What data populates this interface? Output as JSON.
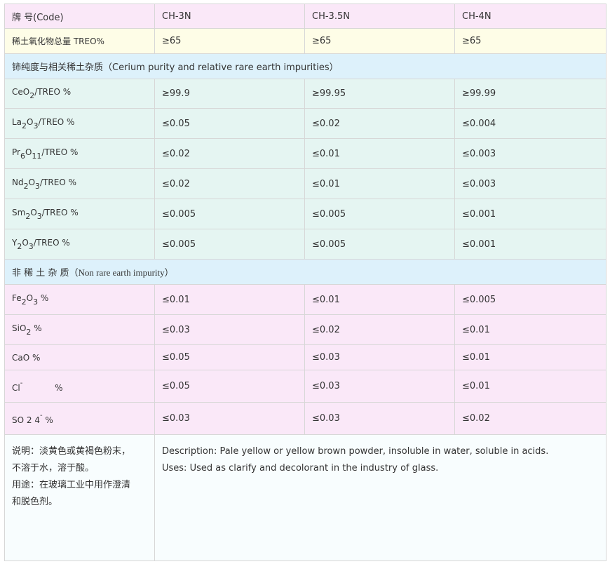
{
  "header": {
    "code_label": "牌 号(Code)",
    "grades": [
      "CH-3N",
      "CH-3.5N",
      "CH-4N"
    ]
  },
  "treo": {
    "label": "稀土氧化物总量 TREO%",
    "values": [
      "≥65",
      "≥65",
      "≥65"
    ]
  },
  "section1": {
    "title": "铈纯度与相关稀土杂质（Cerium purity and relative rare earth impurities）"
  },
  "ree_rows": [
    {
      "formula": [
        {
          "t": "CeO"
        },
        {
          "s": "2"
        },
        {
          "t": "/TREO %"
        }
      ],
      "values": [
        "≥99.9",
        "≥99.95",
        "≥99.99"
      ]
    },
    {
      "formula": [
        {
          "t": "La"
        },
        {
          "s": "2"
        },
        {
          "t": "O"
        },
        {
          "s": "3"
        },
        {
          "t": "/TREO %"
        }
      ],
      "values": [
        "≤0.05",
        "≤0.02",
        "≤0.004"
      ]
    },
    {
      "formula": [
        {
          "t": "Pr"
        },
        {
          "s": "6"
        },
        {
          "t": "O"
        },
        {
          "s": "11"
        },
        {
          "t": "/TREO %"
        }
      ],
      "values": [
        "≤0.02",
        "≤0.01",
        "≤0.003"
      ]
    },
    {
      "formula": [
        {
          "t": "Nd"
        },
        {
          "s": "2"
        },
        {
          "t": "O"
        },
        {
          "s": "3"
        },
        {
          "t": "/TREO %"
        }
      ],
      "values": [
        "≤0.02",
        "≤0.01",
        "≤0.003"
      ]
    },
    {
      "formula": [
        {
          "t": "Sm"
        },
        {
          "s": "2"
        },
        {
          "t": "O"
        },
        {
          "s": "3"
        },
        {
          "t": "/TREO %"
        }
      ],
      "values": [
        "≤0.005",
        "≤0.005",
        "≤0.001"
      ]
    },
    {
      "formula": [
        {
          "t": "Y"
        },
        {
          "s": "2"
        },
        {
          "t": "O"
        },
        {
          "s": "3"
        },
        {
          "t": "/TREO %"
        }
      ],
      "values": [
        "≤0.005",
        "≤0.005",
        "≤0.001"
      ]
    }
  ],
  "section2": {
    "title_cn": "非 稀 土 杂 质",
    "title_en": "（Non rare earth impurity）"
  },
  "non_ree_rows": [
    {
      "formula": [
        {
          "t": "Fe"
        },
        {
          "s": "2"
        },
        {
          "t": "O"
        },
        {
          "s": "3"
        },
        {
          "t": " %"
        }
      ],
      "values": [
        "≤0.01",
        "≤0.01",
        "≤0.005"
      ]
    },
    {
      "formula": [
        {
          "t": "SiO"
        },
        {
          "s": "2"
        },
        {
          "t": " %"
        }
      ],
      "values": [
        "≤0.03",
        "≤0.02",
        "≤0.01"
      ]
    },
    {
      "formula": [
        {
          "t": "CaO %"
        }
      ],
      "values": [
        "≤0.05",
        "≤0.03",
        "≤0.01"
      ]
    },
    {
      "formula": [
        {
          "t": "Cl"
        },
        {
          "p": "-"
        },
        {
          "t": "            %"
        }
      ],
      "values": [
        "≤0.05",
        "≤0.03",
        "≤0.01"
      ]
    },
    {
      "formula": [
        {
          "t": "SO 2 4"
        },
        {
          "p": "-"
        },
        {
          "t": " %"
        }
      ],
      "values": [
        "≤0.03",
        "≤0.03",
        "≤0.02"
      ]
    }
  ],
  "notes": {
    "cn_lines": [
      "说明：淡黄色或黄褐色粉末，",
      "不溶于水，溶于酸。",
      "用途：在玻璃工业中用作澄清",
      "和脱色剂。"
    ],
    "en_lines": [
      "Description: Pale yellow or yellow brown powder, insoluble in water, soluble in acids.",
      "Uses: Used as clarify and decolorant in the industry of glass."
    ]
  }
}
